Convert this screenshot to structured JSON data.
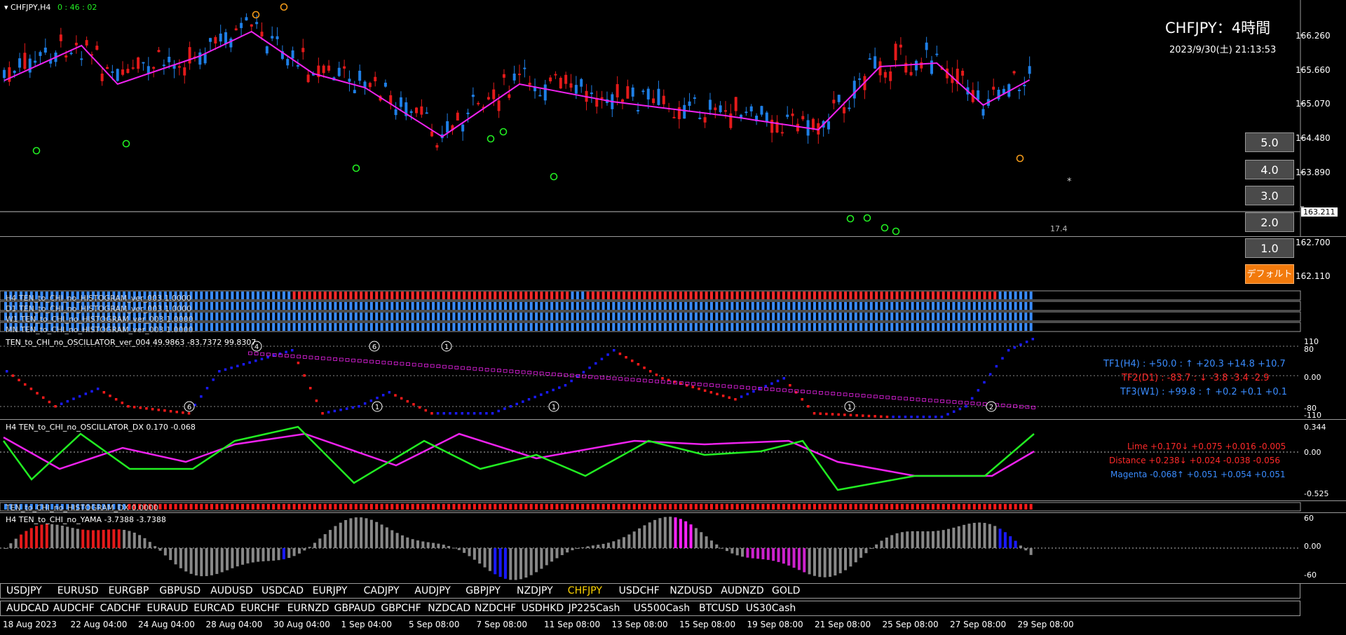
{
  "chart": {
    "symbol_tab": "CHFJPY,H4",
    "countdown": "0 : 46 : 02",
    "title": "CHFJPY：4時間",
    "datetime": "2023/9/30(土) 21:13:53",
    "price_labels": [
      "166.260",
      "165.660",
      "165.070",
      "164.480",
      "163.890",
      "163.211",
      "162.700",
      "162.110"
    ],
    "current_price": "163.211",
    "line_note": "17.4",
    "star": "*"
  },
  "right_buttons": [
    "5.0",
    "4.0",
    "3.0",
    "2.0",
    "1.0",
    "デフォルト"
  ],
  "histograms": [
    "H4 TEN_to_CHI_no_HISTOGRAM_ver_003 1.0000",
    "D1 TEN_to_CHI_no_HISTOGRAM_ver_003 1.0000",
    "W1 TEN_to_CHI_no_HISTOGRAM_ver_003 1.0000",
    "MN TEN_to_CHI_no_HISTOGRAM_ver_003 1.0000"
  ],
  "oscillator": {
    "label": "TEN_to_CHI_no_OSCILLATOR_ver_004 49.9863 -83.7372 99.8307",
    "axis": [
      "110",
      "80",
      "0.00",
      "-80",
      "-110"
    ],
    "tf1": "TF1(H4) : +50.0 : ↑ +20.3 +14.8 +10.7",
    "tf2": "TF2(D1) : -83.7 : ↓ -3.8 -3.4 -2.9",
    "tf3": "TF3(W1) : +99.8 : ↑ +0.2 +0.1 +0.1"
  },
  "oscillator_dx": {
    "label": "H4 TEN_to_CHI_no_OSCILLATOR_DX 0.170 -0.068",
    "axis": [
      "0.344",
      "0.00",
      "-0.525"
    ],
    "lime": "Lime +0.170↓ +0.075 +0.016 -0.005",
    "distance": "Distance +0.238↓ +0.024 -0.038 -0.056",
    "magenta": "Magenta -0.068↑ +0.051 +0.054 +0.051"
  },
  "histogram_dx": {
    "label": "TEN_to_CHI_no_HISTOGRAM_DX 0.0000"
  },
  "yama": {
    "label": "H4  TEN_to_CHI_no_YAMA -3.7388 -3.7388",
    "axis": [
      "60",
      "0.00",
      "-60"
    ]
  },
  "symbols_row1": [
    "USDJPY",
    "EURUSD",
    "EURGBP",
    "GBPUSD",
    "AUDUSD",
    "USDCAD",
    "EURJPY",
    "CADJPY",
    "AUDJPY",
    "GBPJPY",
    "NZDJPY",
    "CHFJPY",
    "USDCHF",
    "NZDUSD",
    "AUDNZD",
    "GOLD"
  ],
  "symbols_row2": [
    "AUDCAD",
    "AUDCHF",
    "CADCHF",
    "EURAUD",
    "EURCAD",
    "EURCHF",
    "EURNZD",
    "GBPAUD",
    "GBPCHF",
    "NZDCAD",
    "NZDCHF",
    "USDHKD",
    "JP225Cash",
    "US500Cash",
    "BTCUSD",
    "US30Cash"
  ],
  "active_symbol": "CHFJPY",
  "time_axis": [
    "18 Aug 2023",
    "22 Aug 04:00",
    "24 Aug 04:00",
    "28 Aug 04:00",
    "30 Aug 04:00",
    "1 Sep 04:00",
    "5 Sep 08:00",
    "7 Sep 08:00",
    "11 Sep 08:00",
    "13 Sep 08:00",
    "15 Sep 08:00",
    "19 Sep 08:00",
    "21 Sep 08:00",
    "25 Sep 08:00",
    "27 Sep 08:00",
    "29 Sep 08:00"
  ],
  "colors": {
    "bull": "#1e7fe6",
    "bear": "#e41a1a",
    "ma": "#ee22ee",
    "lime": "#22ee22",
    "osc_red": "#ff1a1a",
    "osc_blue": "#1a1aff",
    "text_blue": "#3a8cff",
    "text_red": "#ff2a2a"
  }
}
